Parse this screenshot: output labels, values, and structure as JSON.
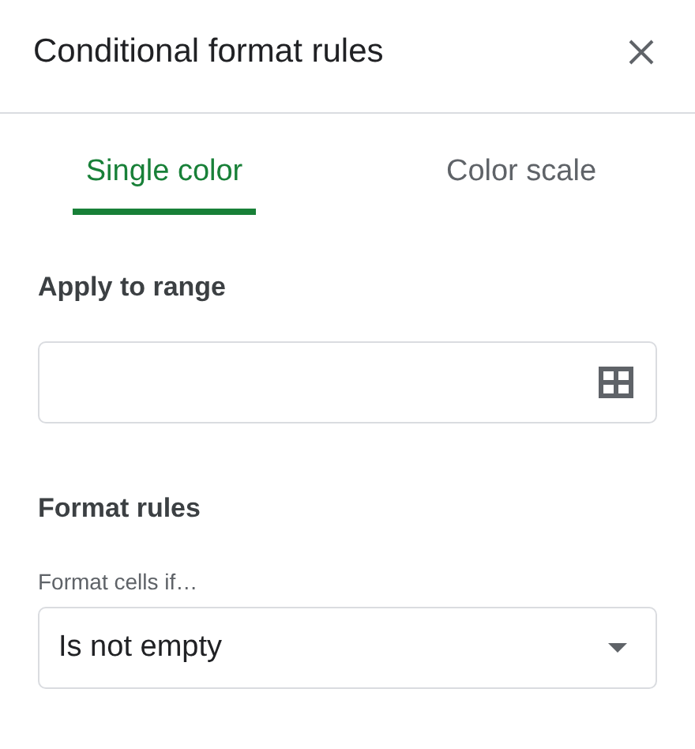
{
  "panel": {
    "title": "Conditional format rules"
  },
  "tabs": [
    {
      "label": "Single color",
      "selected": true
    },
    {
      "label": "Color scale",
      "selected": false
    }
  ],
  "range": {
    "label": "Apply to range"
  },
  "rules": {
    "heading": "Format rules",
    "condition_label": "Format cells if…",
    "condition_value": "Is not empty"
  }
}
